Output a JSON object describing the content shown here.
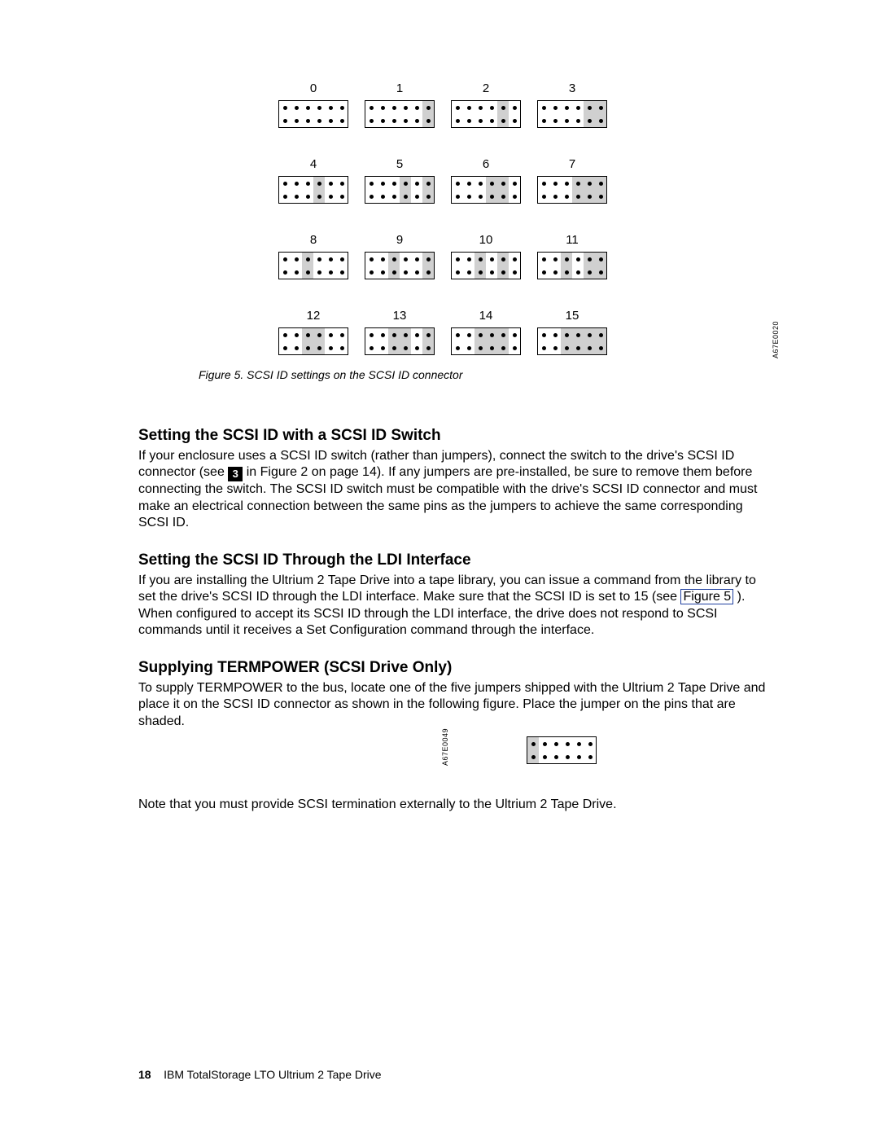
{
  "jumpers": {
    "labels": [
      "0",
      "1",
      "2",
      "3",
      "4",
      "5",
      "6",
      "7",
      "8",
      "9",
      "10",
      "11",
      "12",
      "13",
      "14",
      "15"
    ],
    "side_code": "A67E0020"
  },
  "figure5_caption": "Figure 5. SCSI ID settings on the SCSI ID connector",
  "section1": {
    "heading": "Setting the SCSI ID with a SCSI ID Switch",
    "p1a": "If your enclosure uses a SCSI ID switch (rather than jumpers), connect the switch to the drive's SCSI ID connector (see ",
    "refnum": "3",
    "p1b": " in Figure 2 on page 14). If any jumpers are pre-installed, be sure to remove them before connecting the switch. The SCSI ID switch must be compatible with the drive's SCSI ID connector and must make an electrical connection between the same pins as the jumpers to achieve the same corresponding SCSI ID."
  },
  "section2": {
    "heading": "Setting the SCSI ID Through the LDI Interface",
    "p1a": "If you are installing the Ultrium 2 Tape Drive into a tape library, you can issue a command from the library to set the drive's SCSI ID through the LDI interface. Make sure that the SCSI ID is set to 15 (see ",
    "linktext": "Figure 5",
    "p1b": "). When configured to accept its SCSI ID through the LDI interface, the drive does not respond to SCSI commands until it receives a Set Configuration command through the interface."
  },
  "section3": {
    "heading": "Supplying TERMPOWER (SCSI Drive Only)",
    "p1": "To supply TERMPOWER to the bus, locate one of the five jumpers shipped with the Ultrium 2 Tape Drive and place it on the SCSI ID connector as shown in the following figure. Place the jumper on the pins that are shaded.",
    "side_code": "A67E0049",
    "note": "Note that you must provide SCSI termination externally to the Ultrium 2 Tape Drive."
  },
  "footer": {
    "page": "18",
    "title": "IBM TotalStorage LTO Ultrium 2 Tape Drive"
  },
  "chart_data": {
    "type": "table",
    "title": "SCSI ID jumper shading (columns 0–5, rows top/bottom; 1 = shaded)",
    "settings": [
      {
        "id": 0,
        "top": [
          0,
          0,
          0,
          0,
          0,
          0
        ],
        "bot": [
          0,
          0,
          0,
          0,
          0,
          0
        ]
      },
      {
        "id": 1,
        "top": [
          0,
          0,
          0,
          0,
          0,
          1
        ],
        "bot": [
          0,
          0,
          0,
          0,
          0,
          1
        ]
      },
      {
        "id": 2,
        "top": [
          0,
          0,
          0,
          0,
          1,
          0
        ],
        "bot": [
          0,
          0,
          0,
          0,
          1,
          0
        ]
      },
      {
        "id": 3,
        "top": [
          0,
          0,
          0,
          0,
          1,
          1
        ],
        "bot": [
          0,
          0,
          0,
          0,
          1,
          1
        ]
      },
      {
        "id": 4,
        "top": [
          0,
          0,
          0,
          1,
          0,
          0
        ],
        "bot": [
          0,
          0,
          0,
          1,
          0,
          0
        ]
      },
      {
        "id": 5,
        "top": [
          0,
          0,
          0,
          1,
          0,
          1
        ],
        "bot": [
          0,
          0,
          0,
          1,
          0,
          1
        ]
      },
      {
        "id": 6,
        "top": [
          0,
          0,
          0,
          1,
          1,
          0
        ],
        "bot": [
          0,
          0,
          0,
          1,
          1,
          0
        ]
      },
      {
        "id": 7,
        "top": [
          0,
          0,
          0,
          1,
          1,
          1
        ],
        "bot": [
          0,
          0,
          0,
          1,
          1,
          1
        ]
      },
      {
        "id": 8,
        "top": [
          0,
          0,
          1,
          0,
          0,
          0
        ],
        "bot": [
          0,
          0,
          1,
          0,
          0,
          0
        ]
      },
      {
        "id": 9,
        "top": [
          0,
          0,
          1,
          0,
          0,
          1
        ],
        "bot": [
          0,
          0,
          1,
          0,
          0,
          1
        ]
      },
      {
        "id": 10,
        "top": [
          0,
          0,
          1,
          0,
          1,
          0
        ],
        "bot": [
          0,
          0,
          1,
          0,
          1,
          0
        ]
      },
      {
        "id": 11,
        "top": [
          0,
          0,
          1,
          0,
          1,
          1
        ],
        "bot": [
          0,
          0,
          1,
          0,
          1,
          1
        ]
      },
      {
        "id": 12,
        "top": [
          0,
          0,
          1,
          1,
          0,
          0
        ],
        "bot": [
          0,
          0,
          1,
          1,
          0,
          0
        ]
      },
      {
        "id": 13,
        "top": [
          0,
          0,
          1,
          1,
          0,
          1
        ],
        "bot": [
          0,
          0,
          1,
          1,
          0,
          1
        ]
      },
      {
        "id": 14,
        "top": [
          0,
          0,
          1,
          1,
          1,
          0
        ],
        "bot": [
          0,
          0,
          1,
          1,
          1,
          0
        ]
      },
      {
        "id": 15,
        "top": [
          0,
          0,
          1,
          1,
          1,
          1
        ],
        "bot": [
          0,
          0,
          1,
          1,
          1,
          1
        ]
      }
    ],
    "termpower": {
      "top": [
        1,
        0,
        0,
        0,
        0,
        0
      ],
      "bot": [
        1,
        0,
        0,
        0,
        0,
        0
      ]
    }
  }
}
